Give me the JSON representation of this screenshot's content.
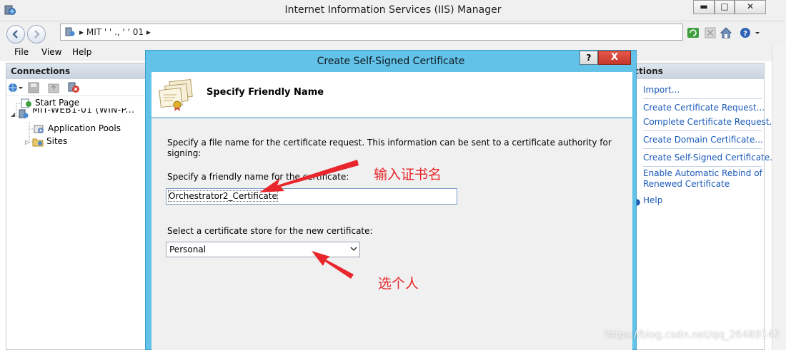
{
  "window": {
    "title": "Internet Information Services (IIS) Manager",
    "minimize_glyph": "▬",
    "maximize_glyph": "□",
    "close_glyph": "✕"
  },
  "address": {
    "path_text": "▸  MIT  ' '   .,  '  ' 01  ▸"
  },
  "menu": {
    "items": [
      "File",
      "View",
      "Help"
    ]
  },
  "connections": {
    "header": "Connections",
    "tree": {
      "start_page": "Start Page",
      "server": "MIT-WEB1-01 (WIN-P...",
      "app_pools": "Application Pools",
      "sites": "Sites"
    }
  },
  "actions": {
    "header": "ctions",
    "items": [
      "Import...",
      "Create Certificate Request...",
      "Complete Certificate Request...",
      "Create Domain Certificate...",
      "Create Self-Signed Certificate...",
      "Enable Automatic Rebind of",
      "Renewed Certificate",
      "Help"
    ]
  },
  "dialog": {
    "title": "Create Self-Signed Certificate",
    "help_button": "?",
    "close_button": "X",
    "heading": "Specify Friendly Name",
    "description_line1": "Specify a file name for the certificate request.  This information can be sent to a certificate authority for",
    "description_line2": "signing:",
    "friendly_label": "Specify a friendly name for the certificate:",
    "friendly_value": "Orchestrator2_Certificate",
    "store_label": "Select a certificate store for the new certificate:",
    "store_value": "Personal"
  },
  "annotations": {
    "friendly_note": "输入证书名",
    "store_note": "选个人",
    "color": "#e8262b"
  },
  "watermark": "https://blog.csdn.net/qq_26489147",
  "colors": {
    "dialog_frame": "#62c2e8",
    "link": "#1a59b8",
    "close_red": "#c4372b"
  }
}
